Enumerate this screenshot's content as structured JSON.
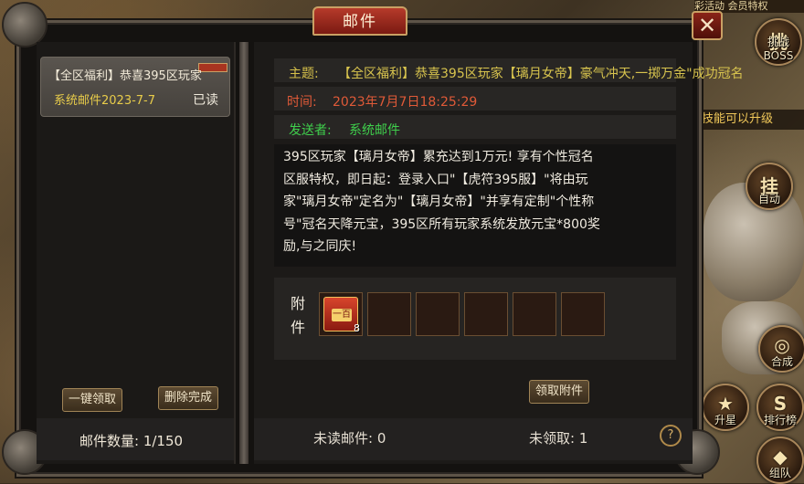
{
  "window": {
    "title": "邮件",
    "close_glyph": "✕"
  },
  "background": {
    "top_strip": "彩活动  会员特权",
    "hint": "技能可以升级",
    "side_buttons": [
      {
        "glyph": "挑",
        "label": "挑战BOSS"
      },
      {
        "glyph": "挂",
        "label": "自动"
      },
      {
        "glyph": "◎",
        "label": "合成"
      },
      {
        "glyph": "★",
        "label": "升星"
      },
      {
        "glyph": "S",
        "label": "排行榜"
      },
      {
        "glyph": "◆",
        "label": "组队"
      }
    ]
  },
  "mail_list": {
    "items": [
      {
        "subject": "【全区福利】恭喜395区玩家",
        "date": "系统邮件2023-7-7",
        "status": "已读"
      }
    ],
    "claim_all_label": "一键领取",
    "delete_done_label": "删除完成",
    "count_label": "邮件数量: 1/150"
  },
  "mail_detail": {
    "subject_label": "主题:",
    "subject": "【全区福利】恭喜395区玩家【璃月女帝】豪气冲天,一掷万金\"成功冠名",
    "time_label": "时间:",
    "time": "2023年7月7日18:25:29",
    "sender_label": "发送者:",
    "sender": "系统邮件",
    "body": "395区玩家【璃月女帝】累充达到1万元! 享有个性冠名区服特权，即日起：登录入口\"【虎符395服】\"将由玩家\"璃月女帝\"定名为\"【璃月女帝】\"并享有定制\"个性称号\"冠名天降元宝，395区所有玩家系统发放元宝*800奖励,与之同庆!",
    "attachment_label_1": "附",
    "attachment_label_2": "件",
    "attachments": [
      {
        "icon": "red-envelope-icon",
        "seal": "一百",
        "count": "8"
      }
    ],
    "empty_slots": 5,
    "claim_attachment_label": "领取附件"
  },
  "footer": {
    "unread": "未读邮件: 0",
    "unclaimed": "未领取: 1",
    "help_glyph": "?"
  }
}
